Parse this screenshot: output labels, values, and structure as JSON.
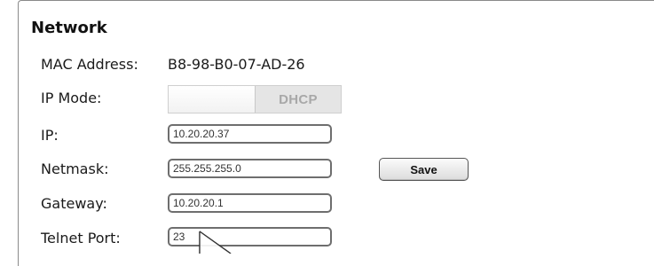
{
  "network": {
    "title": "Network",
    "mac": {
      "label": "MAC Address:",
      "value": "B8-98-B0-07-AD-26"
    },
    "ip_mode": {
      "label": "IP Mode:",
      "toggle_text": "DHCP",
      "dhcp_enabled": false
    },
    "ip": {
      "label": "IP:",
      "value": "10.20.20.37"
    },
    "netmask": {
      "label": "Netmask:",
      "value": "255.255.255.0"
    },
    "gateway": {
      "label": "Gateway:",
      "value": "10.20.20.1"
    },
    "telnet_port": {
      "label": "Telnet Port:",
      "value": "23"
    },
    "save_label": "Save"
  },
  "cursor_icon": "mouse-pointer-icon"
}
